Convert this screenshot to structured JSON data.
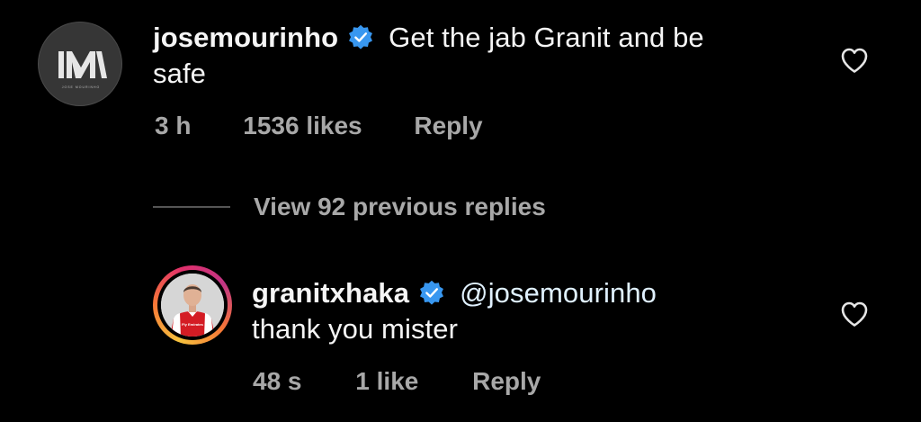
{
  "comments": [
    {
      "username": "josemourinho",
      "verified": true,
      "text_line1": "Get the jab Granit and be",
      "text_line2": "safe",
      "time": "3 h",
      "likes": "1536 likes",
      "reply_label": "Reply",
      "avatar_monogram": "JM",
      "avatar_caption": "JOSE MOURINHO"
    },
    {
      "username": "granitxhaka",
      "verified": true,
      "mention": "@josemourinho",
      "text_line2": "thank you mister",
      "time": "48 s",
      "likes": "1 like",
      "reply_label": "Reply",
      "jersey_text": "Fly Emirates"
    }
  ],
  "view_replies": "View 92 previous replies",
  "colors": {
    "background": "#000000",
    "text": "#f5f5f5",
    "meta": "#a8a8a8",
    "verified": "#3897f0"
  }
}
